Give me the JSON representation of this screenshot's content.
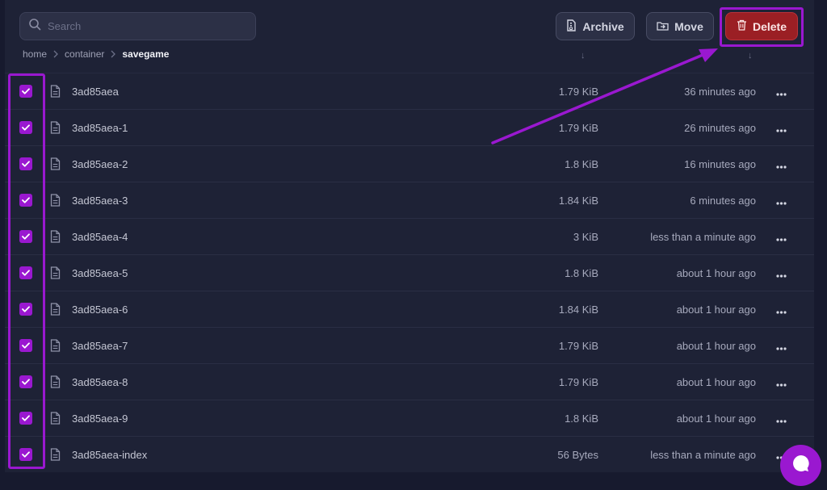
{
  "search": {
    "placeholder": "Search"
  },
  "toolbar": {
    "archive_label": "Archive",
    "move_label": "Move",
    "delete_label": "Delete"
  },
  "breadcrumb": [
    "home",
    "container",
    "savegame"
  ],
  "sort_indicator": "↓",
  "colors": {
    "accent": "#9a18d0",
    "delete": "#9b1f24",
    "background": "#171a2e",
    "panel": "#1e2236"
  },
  "files": [
    {
      "name": "3ad85aea",
      "size": "1.79 KiB",
      "modified": "36 minutes ago"
    },
    {
      "name": "3ad85aea-1",
      "size": "1.79 KiB",
      "modified": "26 minutes ago"
    },
    {
      "name": "3ad85aea-2",
      "size": "1.8 KiB",
      "modified": "16 minutes ago"
    },
    {
      "name": "3ad85aea-3",
      "size": "1.84 KiB",
      "modified": "6 minutes ago"
    },
    {
      "name": "3ad85aea-4",
      "size": "3 KiB",
      "modified": "less than a minute ago"
    },
    {
      "name": "3ad85aea-5",
      "size": "1.8 KiB",
      "modified": "about 1 hour ago"
    },
    {
      "name": "3ad85aea-6",
      "size": "1.84 KiB",
      "modified": "about 1 hour ago"
    },
    {
      "name": "3ad85aea-7",
      "size": "1.79 KiB",
      "modified": "about 1 hour ago"
    },
    {
      "name": "3ad85aea-8",
      "size": "1.79 KiB",
      "modified": "about 1 hour ago"
    },
    {
      "name": "3ad85aea-9",
      "size": "1.8 KiB",
      "modified": "about 1 hour ago"
    },
    {
      "name": "3ad85aea-index",
      "size": "56 Bytes",
      "modified": "less than a minute ago"
    }
  ]
}
